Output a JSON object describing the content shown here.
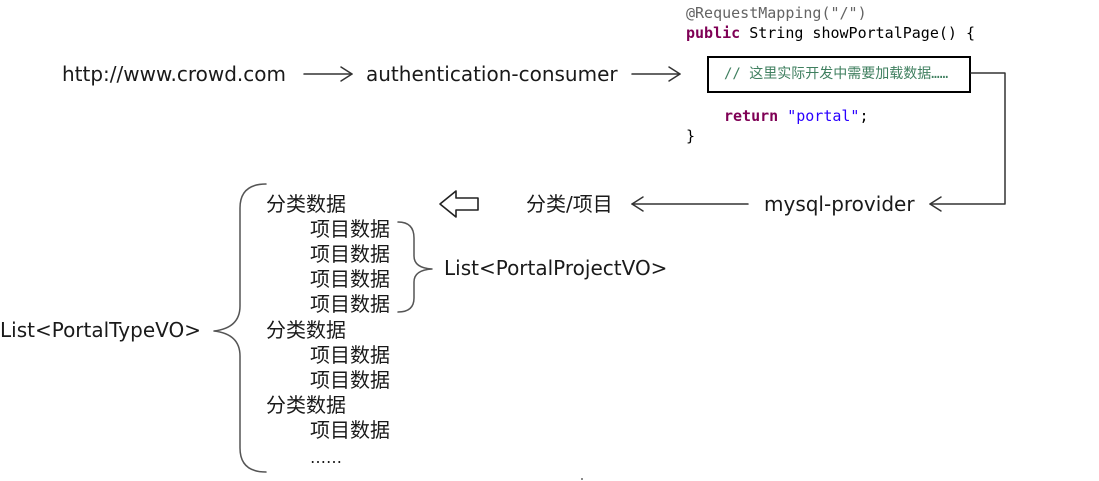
{
  "flow": {
    "url": "http://www.crowd.com",
    "consumer": "authentication-consumer",
    "provider": "mysql-provider",
    "category_project": "分类/项目"
  },
  "code": {
    "annotation": "@RequestMapping(\"/\")",
    "signature_kw": "public",
    "signature_rest": " String showPortalPage() {",
    "comment": "// 这里实际开发中需要加载数据……",
    "return_kw": "return",
    "return_str": "\"portal\"",
    "return_end": ";",
    "close": "}"
  },
  "tree": {
    "outer_label": "List<PortalTypeVO>",
    "inner_label": "List<PortalProjectVO>",
    "category": "分类数据",
    "project": "项目数据",
    "ellipsis": "……"
  }
}
